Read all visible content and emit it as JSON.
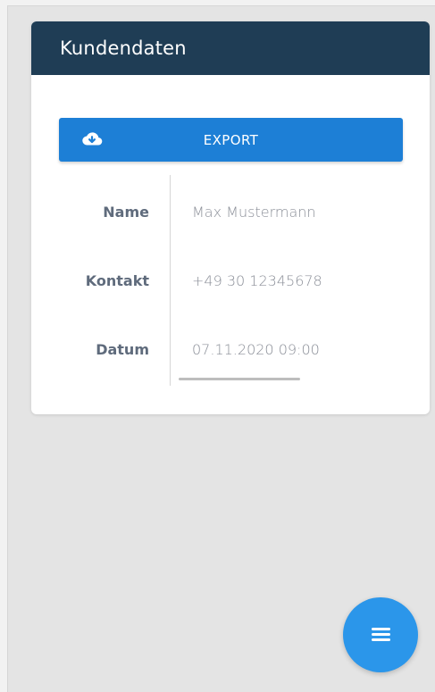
{
  "card": {
    "title": "Kundendaten"
  },
  "export": {
    "label": "EXPORT",
    "icon": "cloud-download-icon"
  },
  "details": {
    "name_label": "Name",
    "name_value": "Max Mustermann",
    "contact_label": "Kontakt",
    "contact_value": "+49 30 12345678",
    "date_label": "Datum",
    "date_value": "07.11.2020 09:00"
  },
  "fab": {
    "icon": "menu-icon"
  },
  "colors": {
    "header": "#1f3d55",
    "button": "#1d7fd6",
    "fab": "#2b96ea",
    "background": "#e4e4e4"
  }
}
